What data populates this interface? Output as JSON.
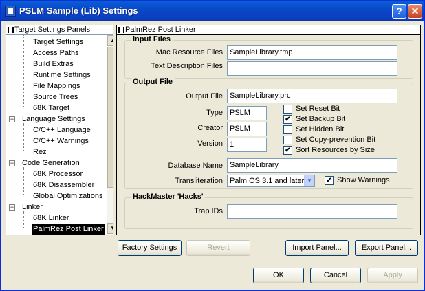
{
  "window": {
    "title": "PSLM Sample (Lib) Settings",
    "help_label": "?",
    "close_label": "✕"
  },
  "sidebar": {
    "header": "Target Settings Panels",
    "items": [
      {
        "label": "Target Settings",
        "level": 1
      },
      {
        "label": "Access Paths",
        "level": 1
      },
      {
        "label": "Build Extras",
        "level": 1
      },
      {
        "label": "Runtime Settings",
        "level": 1
      },
      {
        "label": "File Mappings",
        "level": 1
      },
      {
        "label": "Source Trees",
        "level": 1
      },
      {
        "label": "68K Target",
        "level": 1
      },
      {
        "label": "Language Settings",
        "level": 0
      },
      {
        "label": "C/C++ Language",
        "level": 1
      },
      {
        "label": "C/C++ Warnings",
        "level": 1
      },
      {
        "label": "Rez",
        "level": 1
      },
      {
        "label": "Code Generation",
        "level": 0
      },
      {
        "label": "68K Processor",
        "level": 1
      },
      {
        "label": "68K Disassembler",
        "level": 1
      },
      {
        "label": "Global Optimizations",
        "level": 1
      },
      {
        "label": "Linker",
        "level": 0
      },
      {
        "label": "68K Linker",
        "level": 1
      },
      {
        "label": "PalmRez Post Linker",
        "level": 1,
        "selected": true
      }
    ],
    "expander_symbol": "−",
    "scroll_up": "▲",
    "scroll_down": "▼"
  },
  "panel": {
    "header": "PalmRez Post Linker",
    "input_files": {
      "title": "Input Files",
      "mac_resource_label": "Mac Resource Files",
      "mac_resource_value": "SampleLibrary.tmp",
      "text_desc_label": "Text Description Files",
      "text_desc_value": ""
    },
    "output_file": {
      "title": "Output File",
      "output_label": "Output File",
      "output_value": "SampleLibrary.prc",
      "type_label": "Type",
      "type_value": "PSLM",
      "creator_label": "Creator",
      "creator_value": "PSLM",
      "version_label": "Version",
      "version_value": "1",
      "checkboxes": [
        {
          "label": "Set Reset Bit",
          "checked": false
        },
        {
          "label": "Set Backup Bit",
          "checked": true
        },
        {
          "label": "Set Hidden Bit",
          "checked": false
        },
        {
          "label": "Set Copy-prevention Bit",
          "checked": false
        },
        {
          "label": "Sort Resources by Size",
          "checked": true
        }
      ],
      "dbname_label": "Database Name",
      "dbname_value": "SampleLibrary",
      "translit_label": "Transliteration",
      "translit_value": "Palm OS 3.1 and later",
      "show_warnings_label": "Show Warnings",
      "show_warnings_checked": true
    },
    "hackmaster": {
      "title": "HackMaster 'Hacks'",
      "trap_label": "Trap IDs",
      "trap_value": ""
    }
  },
  "buttons": {
    "factory": "Factory Settings",
    "revert": "Revert",
    "import": "Import Panel...",
    "export": "Export Panel...",
    "ok": "OK",
    "cancel": "Cancel",
    "apply": "Apply"
  },
  "check_mark": "✔"
}
